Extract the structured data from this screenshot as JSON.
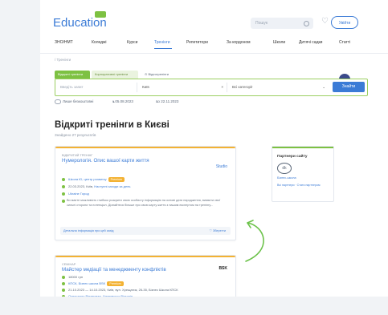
{
  "header": {
    "logo": "Education",
    "search_placeholder": "Пошук",
    "login": "Увійти"
  },
  "nav": {
    "items": [
      "ЗНО/НМТ",
      "Коледжі",
      "Курси",
      "Тренінги",
      "Репетитори",
      "За кордоном",
      "Школи",
      "Дитячі садки",
      "Статті"
    ],
    "active_index": 3
  },
  "breadcrumb": "Тренінги",
  "filter": {
    "tabs": [
      "Відкриті тренінги",
      "Корпоративні тренінги",
      "Відеотренінги"
    ],
    "search_placeholder": "Введіть запит",
    "city": "Київ",
    "category": "Всі категорії",
    "submit": "Знайти",
    "extra": {
      "online_label": "Лише безкоштовні",
      "date_from": "з 05.08.2023",
      "date_to": "по 22.11.2023"
    }
  },
  "page": {
    "title": "Відкриті тренінги в Києві",
    "subtitle": "Знайдено 27 результатів"
  },
  "cards": [
    {
      "kicker": "Відкритий тренінг",
      "title": "Нумерологія. Опис вашої карти життя",
      "provider_logo": "Studio",
      "provider": "Школа Ю, центр розвитку",
      "badge": "Premium",
      "when": "22.03.2023, Київ,",
      "when_link": "Наступні заходи за день",
      "place": "Ukraine Город",
      "description": "Ви маєте можливість глибоко розкрити свою особисту інформацію на основі дати народження, виявити свої сильні сторони та потенціал. Дізнайтеся більше про свою карту життя з нашим експертом на тренінгу...",
      "foot_left": "Детальна інформація про цей захід",
      "foot_right": "Зберегти"
    },
    {
      "kicker": "Семінар",
      "title": "Майстер медіації та менеджменту конфліктів",
      "provider_logo": "BSK",
      "price": "18000 грн",
      "provider": "КПСК, Бізнес школа BSK",
      "badge": "Premium",
      "when": "21.10.2023 — 14.10.2023, Київ, вул. Хрещатик, 26-35, Бізнес Школа КПСК",
      "trainers": "Олександр Вінтерман, Уляновсько Вікторія",
      "description": "7 днів тренінгу формату медіація, професійні та практичні кейси..."
    }
  ],
  "sidebar": {
    "title": "Партнери сайту",
    "partner_logo": "dk",
    "partner_name": "Бізнес-школа",
    "all_link": "Всі партнери · Стати партнером"
  }
}
